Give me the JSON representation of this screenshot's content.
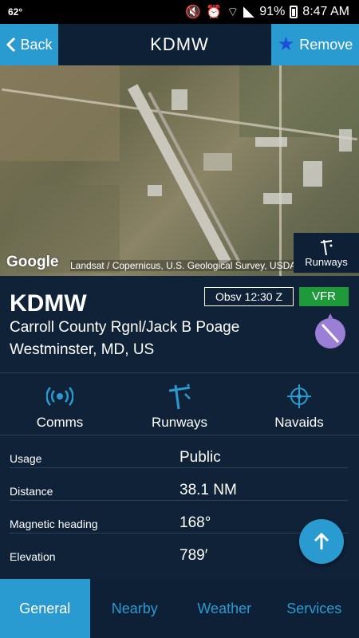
{
  "status_bar": {
    "temperature": "62°",
    "battery": "91%",
    "time": "8:47 AM"
  },
  "header": {
    "back_label": "Back",
    "title": "KDMW",
    "remove_label": "Remove"
  },
  "map": {
    "attribution": "Landsat / Copernicus, U.S. Geological Survey, USDA Farm Ser",
    "google_logo": "Google",
    "runways_label": "Runways"
  },
  "airport": {
    "code": "KDMW",
    "name": "Carroll County Rgnl/Jack B Poage",
    "location": "Westminster, MD, US",
    "observation": "Obsv 12:30 Z",
    "flight_category": "VFR",
    "flight_category_color": "#1f9a3b"
  },
  "actions": [
    {
      "label": "Comms",
      "icon": "radio-waves-icon"
    },
    {
      "label": "Runways",
      "icon": "runway-icon"
    },
    {
      "label": "Navaids",
      "icon": "compass-rose-icon"
    }
  ],
  "details": [
    {
      "label": "Usage",
      "value": "Public"
    },
    {
      "label": "Distance",
      "value": "38.1 NM"
    },
    {
      "label": "Magnetic heading",
      "value": "168°"
    },
    {
      "label": "Elevation",
      "value": "789′"
    }
  ],
  "tabs": [
    {
      "label": "General",
      "active": true
    },
    {
      "label": "Nearby",
      "active": false
    },
    {
      "label": "Weather",
      "active": false
    },
    {
      "label": "Services",
      "active": false
    }
  ],
  "colors": {
    "accent": "#2a9bd1",
    "background": "#0f2238",
    "header": "#0e2036"
  }
}
